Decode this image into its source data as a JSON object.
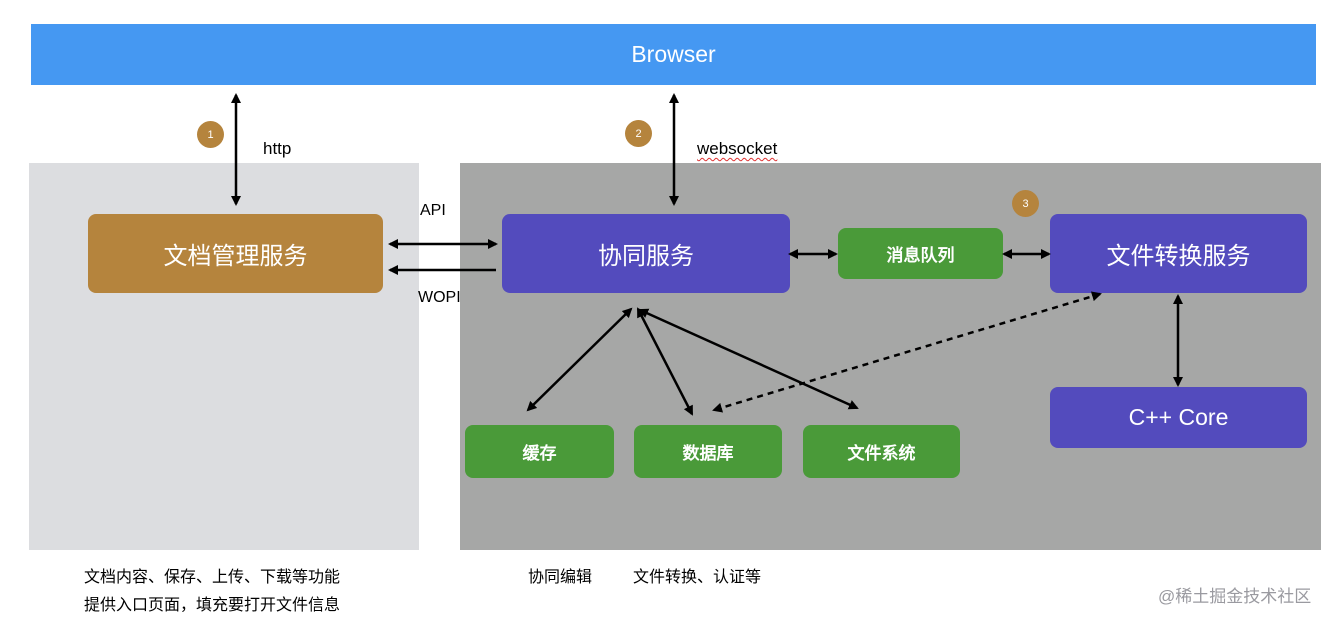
{
  "colors": {
    "browser_bg": "#4598f2",
    "left_panel_bg": "#dcdde0",
    "right_panel_bg": "#a6a7a6",
    "doc_service_bg": "#b5843d",
    "purple_service_bg": "#534bbd",
    "green_service_bg": "#4a9a39",
    "badge_bg": "#b5843d"
  },
  "browser": {
    "label": "Browser"
  },
  "badges": [
    "1",
    "2",
    "3"
  ],
  "edge_labels": {
    "http": "http",
    "websocket": "websocket",
    "api": "API",
    "wopi": "WOPI"
  },
  "services": {
    "doc_management": "文档管理服务",
    "collaboration": "协同服务",
    "message_queue": "消息队列",
    "file_conversion": "文件转换服务",
    "cpp_core": "C++ Core",
    "cache": "缓存",
    "database": "数据库",
    "file_system": "文件系统"
  },
  "captions": {
    "left_line1": "文档内容、保存、上传、下载等功能",
    "left_line2": "提供入口页面，填充要打开文件信息",
    "right_part1": "协同编辑",
    "right_part2": "文件转换、认证等"
  },
  "watermark": "@稀土掘金技术社区"
}
